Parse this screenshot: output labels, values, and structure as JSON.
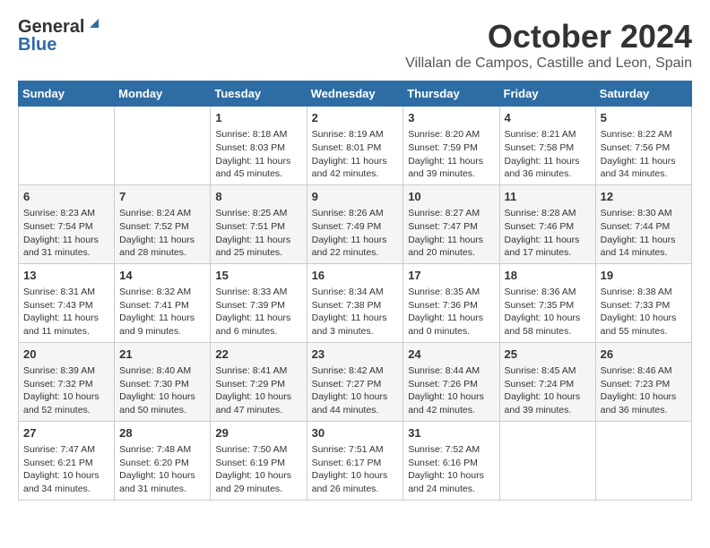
{
  "header": {
    "logo_general": "General",
    "logo_blue": "Blue",
    "month": "October 2024",
    "location": "Villalan de Campos, Castille and Leon, Spain"
  },
  "weekdays": [
    "Sunday",
    "Monday",
    "Tuesday",
    "Wednesday",
    "Thursday",
    "Friday",
    "Saturday"
  ],
  "weeks": [
    [
      {
        "day": "",
        "info": ""
      },
      {
        "day": "",
        "info": ""
      },
      {
        "day": "1",
        "info": "Sunrise: 8:18 AM\nSunset: 8:03 PM\nDaylight: 11 hours and 45 minutes."
      },
      {
        "day": "2",
        "info": "Sunrise: 8:19 AM\nSunset: 8:01 PM\nDaylight: 11 hours and 42 minutes."
      },
      {
        "day": "3",
        "info": "Sunrise: 8:20 AM\nSunset: 7:59 PM\nDaylight: 11 hours and 39 minutes."
      },
      {
        "day": "4",
        "info": "Sunrise: 8:21 AM\nSunset: 7:58 PM\nDaylight: 11 hours and 36 minutes."
      },
      {
        "day": "5",
        "info": "Sunrise: 8:22 AM\nSunset: 7:56 PM\nDaylight: 11 hours and 34 minutes."
      }
    ],
    [
      {
        "day": "6",
        "info": "Sunrise: 8:23 AM\nSunset: 7:54 PM\nDaylight: 11 hours and 31 minutes."
      },
      {
        "day": "7",
        "info": "Sunrise: 8:24 AM\nSunset: 7:52 PM\nDaylight: 11 hours and 28 minutes."
      },
      {
        "day": "8",
        "info": "Sunrise: 8:25 AM\nSunset: 7:51 PM\nDaylight: 11 hours and 25 minutes."
      },
      {
        "day": "9",
        "info": "Sunrise: 8:26 AM\nSunset: 7:49 PM\nDaylight: 11 hours and 22 minutes."
      },
      {
        "day": "10",
        "info": "Sunrise: 8:27 AM\nSunset: 7:47 PM\nDaylight: 11 hours and 20 minutes."
      },
      {
        "day": "11",
        "info": "Sunrise: 8:28 AM\nSunset: 7:46 PM\nDaylight: 11 hours and 17 minutes."
      },
      {
        "day": "12",
        "info": "Sunrise: 8:30 AM\nSunset: 7:44 PM\nDaylight: 11 hours and 14 minutes."
      }
    ],
    [
      {
        "day": "13",
        "info": "Sunrise: 8:31 AM\nSunset: 7:43 PM\nDaylight: 11 hours and 11 minutes."
      },
      {
        "day": "14",
        "info": "Sunrise: 8:32 AM\nSunset: 7:41 PM\nDaylight: 11 hours and 9 minutes."
      },
      {
        "day": "15",
        "info": "Sunrise: 8:33 AM\nSunset: 7:39 PM\nDaylight: 11 hours and 6 minutes."
      },
      {
        "day": "16",
        "info": "Sunrise: 8:34 AM\nSunset: 7:38 PM\nDaylight: 11 hours and 3 minutes."
      },
      {
        "day": "17",
        "info": "Sunrise: 8:35 AM\nSunset: 7:36 PM\nDaylight: 11 hours and 0 minutes."
      },
      {
        "day": "18",
        "info": "Sunrise: 8:36 AM\nSunset: 7:35 PM\nDaylight: 10 hours and 58 minutes."
      },
      {
        "day": "19",
        "info": "Sunrise: 8:38 AM\nSunset: 7:33 PM\nDaylight: 10 hours and 55 minutes."
      }
    ],
    [
      {
        "day": "20",
        "info": "Sunrise: 8:39 AM\nSunset: 7:32 PM\nDaylight: 10 hours and 52 minutes."
      },
      {
        "day": "21",
        "info": "Sunrise: 8:40 AM\nSunset: 7:30 PM\nDaylight: 10 hours and 50 minutes."
      },
      {
        "day": "22",
        "info": "Sunrise: 8:41 AM\nSunset: 7:29 PM\nDaylight: 10 hours and 47 minutes."
      },
      {
        "day": "23",
        "info": "Sunrise: 8:42 AM\nSunset: 7:27 PM\nDaylight: 10 hours and 44 minutes."
      },
      {
        "day": "24",
        "info": "Sunrise: 8:44 AM\nSunset: 7:26 PM\nDaylight: 10 hours and 42 minutes."
      },
      {
        "day": "25",
        "info": "Sunrise: 8:45 AM\nSunset: 7:24 PM\nDaylight: 10 hours and 39 minutes."
      },
      {
        "day": "26",
        "info": "Sunrise: 8:46 AM\nSunset: 7:23 PM\nDaylight: 10 hours and 36 minutes."
      }
    ],
    [
      {
        "day": "27",
        "info": "Sunrise: 7:47 AM\nSunset: 6:21 PM\nDaylight: 10 hours and 34 minutes."
      },
      {
        "day": "28",
        "info": "Sunrise: 7:48 AM\nSunset: 6:20 PM\nDaylight: 10 hours and 31 minutes."
      },
      {
        "day": "29",
        "info": "Sunrise: 7:50 AM\nSunset: 6:19 PM\nDaylight: 10 hours and 29 minutes."
      },
      {
        "day": "30",
        "info": "Sunrise: 7:51 AM\nSunset: 6:17 PM\nDaylight: 10 hours and 26 minutes."
      },
      {
        "day": "31",
        "info": "Sunrise: 7:52 AM\nSunset: 6:16 PM\nDaylight: 10 hours and 24 minutes."
      },
      {
        "day": "",
        "info": ""
      },
      {
        "day": "",
        "info": ""
      }
    ]
  ]
}
